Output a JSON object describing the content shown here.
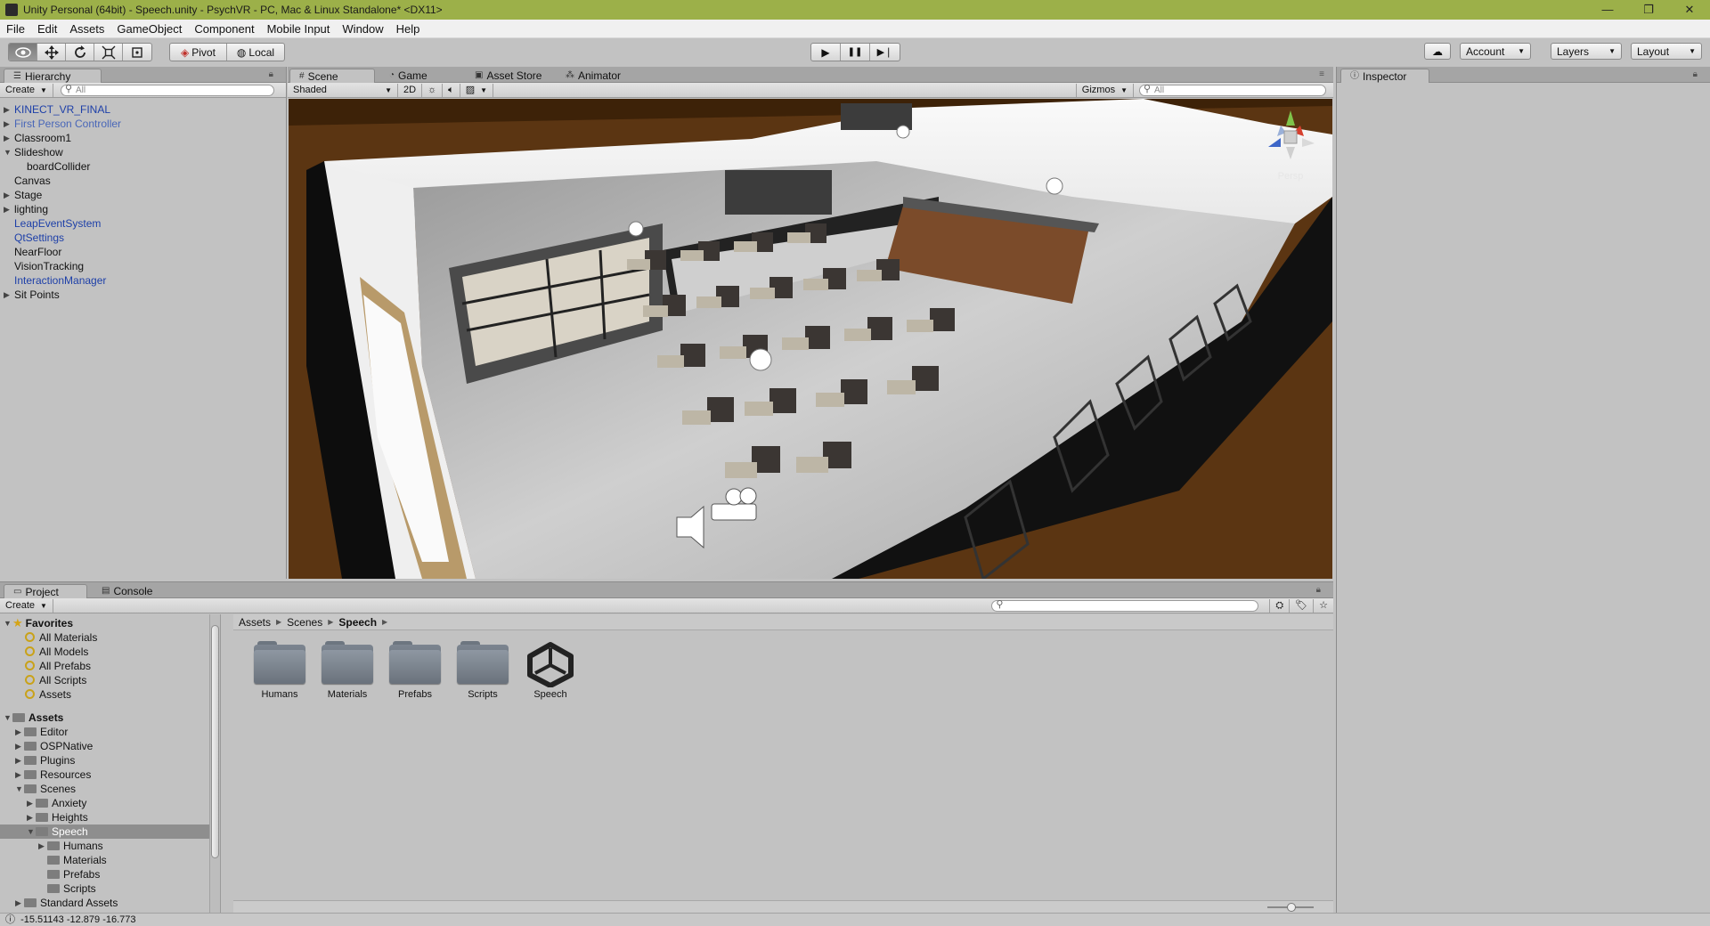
{
  "window": {
    "title": "Unity Personal (64bit) - Speech.unity - PsychVR - PC, Mac & Linux Standalone* <DX11>",
    "minimize": "—",
    "restore": "❐",
    "close": "✕"
  },
  "menu": [
    "File",
    "Edit",
    "Assets",
    "GameObject",
    "Component",
    "Mobile Input",
    "Window",
    "Help"
  ],
  "toolbar": {
    "tools": [
      "view-hand-icon",
      "move-icon",
      "rotate-icon",
      "scale-icon",
      "rect-icon"
    ],
    "pivot": "Pivot",
    "local": "Local",
    "play": "▶",
    "pause": "❚❚",
    "step": "▶❘",
    "account": "Account",
    "layers": "Layers",
    "layout": "Layout"
  },
  "hierarchy": {
    "tab": "Hierarchy",
    "create": "Create",
    "search_placeholder": "All",
    "items": [
      {
        "label": "KINECT_VR_FINAL",
        "expandable": true,
        "color": "blue"
      },
      {
        "label": "First Person Controller",
        "expandable": true,
        "color": "lightblue"
      },
      {
        "label": "Classroom1",
        "expandable": true,
        "color": "black"
      },
      {
        "label": "Slideshow",
        "expandable": true,
        "expanded": true,
        "color": "black"
      },
      {
        "label": "boardCollider",
        "expandable": false,
        "color": "black",
        "indent": 1
      },
      {
        "label": "Canvas",
        "expandable": false,
        "color": "black"
      },
      {
        "label": "Stage",
        "expandable": true,
        "color": "black"
      },
      {
        "label": "lighting",
        "expandable": true,
        "color": "black"
      },
      {
        "label": "LeapEventSystem",
        "expandable": false,
        "color": "blue"
      },
      {
        "label": "QtSettings",
        "expandable": false,
        "color": "blue"
      },
      {
        "label": "NearFloor",
        "expandable": false,
        "color": "black"
      },
      {
        "label": "VisionTracking",
        "expandable": false,
        "color": "black"
      },
      {
        "label": "InteractionManager",
        "expandable": false,
        "color": "blue"
      },
      {
        "label": "Sit Points",
        "expandable": true,
        "color": "black"
      }
    ]
  },
  "scene": {
    "tabs": [
      "Scene",
      "Game",
      "Asset Store",
      "Animator"
    ],
    "shading": "Shaded",
    "mode_2d": "2D",
    "gizmos": "Gizmos",
    "search_placeholder": "All",
    "persp_label": "Persp"
  },
  "inspector": {
    "tab": "Inspector"
  },
  "project": {
    "tabs": [
      "Project",
      "Console"
    ],
    "create": "Create",
    "favorites_label": "Favorites",
    "favorites": [
      "All Materials",
      "All Models",
      "All Prefabs",
      "All Scripts",
      "Assets"
    ],
    "assets_label": "Assets",
    "tree": [
      {
        "label": "Editor",
        "level": 1,
        "arrow": "▶"
      },
      {
        "label": "OSPNative",
        "level": 1,
        "arrow": "▶"
      },
      {
        "label": "Plugins",
        "level": 1,
        "arrow": "▶"
      },
      {
        "label": "Resources",
        "level": 1,
        "arrow": "▶"
      },
      {
        "label": "Scenes",
        "level": 1,
        "arrow": "▼"
      },
      {
        "label": "Anxiety",
        "level": 2,
        "arrow": "▶"
      },
      {
        "label": "Heights",
        "level": 2,
        "arrow": "▶"
      },
      {
        "label": "Speech",
        "level": 2,
        "arrow": "▼",
        "selected": true
      },
      {
        "label": "Humans",
        "level": 3,
        "arrow": "▶"
      },
      {
        "label": "Materials",
        "level": 3,
        "arrow": ""
      },
      {
        "label": "Prefabs",
        "level": 3,
        "arrow": ""
      },
      {
        "label": "Scripts",
        "level": 3,
        "arrow": ""
      },
      {
        "label": "Standard Assets",
        "level": 1,
        "arrow": "▶"
      }
    ],
    "breadcrumb": [
      "Assets",
      "Scenes",
      "Speech"
    ],
    "items": [
      {
        "label": "Humans",
        "type": "folder"
      },
      {
        "label": "Materials",
        "type": "folder"
      },
      {
        "label": "Prefabs",
        "type": "folder"
      },
      {
        "label": "Scripts",
        "type": "folder"
      },
      {
        "label": "Speech",
        "type": "unity-scene"
      }
    ]
  },
  "status": {
    "text": "-15.51143 -12.879 -16.773"
  },
  "colors": {
    "titlebar": "#9cb049",
    "editor_bg": "#c2c2c2",
    "blue_text": "#1d3fa8"
  }
}
